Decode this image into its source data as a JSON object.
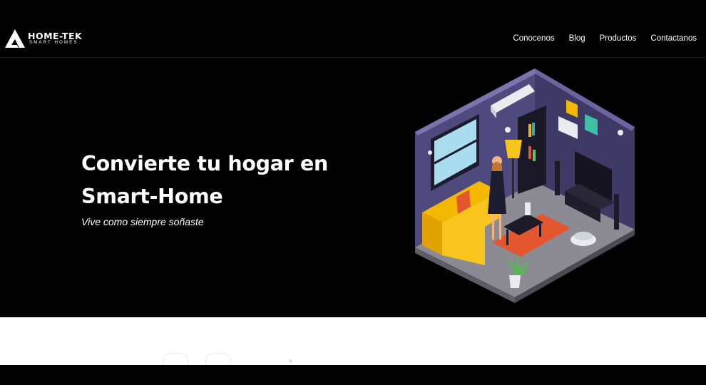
{
  "brand": {
    "name": "HOME-TEK",
    "tagline": "SMART HOMES"
  },
  "nav": {
    "items": [
      {
        "label": "Conocenos"
      },
      {
        "label": "Blog"
      },
      {
        "label": "Productos"
      },
      {
        "label": "Contactanos"
      }
    ]
  },
  "hero": {
    "title": "Convierte tu hogar en Smart-Home",
    "subtitle": "Vive como siempre soñaste",
    "illustration": "smart-home-isometric-room"
  },
  "colors": {
    "background": "#000000",
    "accent_purple": "#4f4a7e",
    "accent_yellow": "#f5b800",
    "floor": "#8c8a92"
  }
}
